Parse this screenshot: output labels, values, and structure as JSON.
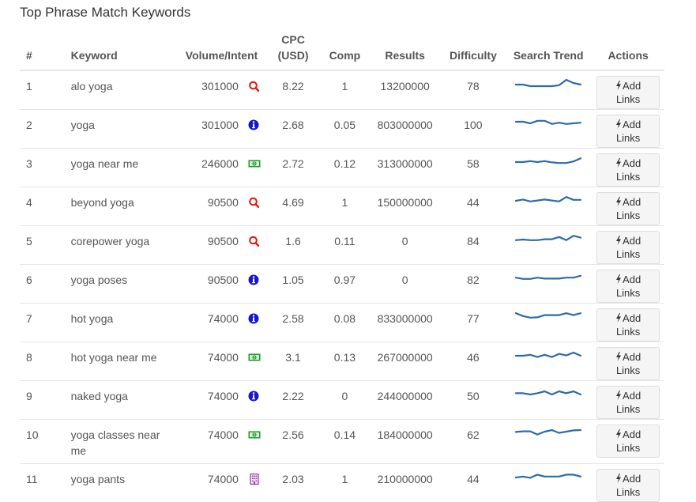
{
  "title": "Top Phrase Match Keywords",
  "colors": {
    "search_intent": "#e8120c",
    "info_intent": "#1515d6",
    "transactional_intent": "#1c9a2b",
    "navigational_intent": "#9b2fae",
    "trend_line": "#2f6aa8"
  },
  "columns": {
    "num": "#",
    "keyword": "Keyword",
    "volume": "Volume/Intent",
    "cpc_line1": "CPC",
    "cpc_line2": "(USD)",
    "comp": "Comp",
    "results": "Results",
    "difficulty": "Difficulty",
    "trend": "Search Trend",
    "actions": "Actions"
  },
  "action_label": "Add Links",
  "rows": [
    {
      "num": "1",
      "keyword": "alo yoga",
      "volume": "301000",
      "intent": "search-icon",
      "cpc": "8.22",
      "comp": "1",
      "results": "13200000",
      "difficulty": "78",
      "trend": [
        5,
        5,
        4.5,
        4.5,
        4.5,
        4.5,
        4.8,
        6.5,
        5.5,
        5
      ]
    },
    {
      "num": "2",
      "keyword": "yoga",
      "volume": "301000",
      "intent": "info-icon",
      "cpc": "2.68",
      "comp": "0.05",
      "results": "803000000",
      "difficulty": "100",
      "trend": [
        5.5,
        5.5,
        5,
        5.8,
        5.8,
        4.8,
        5.2,
        4.8,
        5,
        5.2
      ]
    },
    {
      "num": "3",
      "keyword": "yoga near me",
      "volume": "246000",
      "intent": "money-icon",
      "cpc": "2.72",
      "comp": "0.12",
      "results": "313000000",
      "difficulty": "58",
      "trend": [
        5,
        5,
        5.3,
        5,
        5.3,
        4.9,
        4.7,
        4.7,
        5.2,
        6.2
      ]
    },
    {
      "num": "4",
      "keyword": "beyond yoga",
      "volume": "90500",
      "intent": "search-icon",
      "cpc": "4.69",
      "comp": "1",
      "results": "150000000",
      "difficulty": "44",
      "trend": [
        5,
        5.4,
        4.8,
        5.1,
        5.4,
        5.1,
        4.8,
        6.2,
        5.3,
        5.3
      ]
    },
    {
      "num": "5",
      "keyword": "corepower yoga",
      "volume": "90500",
      "intent": "search-icon",
      "cpc": "1.6",
      "comp": "0.11",
      "results": "0",
      "difficulty": "84",
      "trend": [
        4.8,
        5,
        4.8,
        4.8,
        5.1,
        5.1,
        5.8,
        4.8,
        6.2,
        5.6
      ]
    },
    {
      "num": "6",
      "keyword": "yoga poses",
      "volume": "90500",
      "intent": "info-icon",
      "cpc": "1.05",
      "comp": "0.97",
      "results": "0",
      "difficulty": "82",
      "trend": [
        5.2,
        4.8,
        4.8,
        5.2,
        4.9,
        4.9,
        4.9,
        5.2,
        5.2,
        5.8
      ]
    },
    {
      "num": "7",
      "keyword": "hot yoga",
      "volume": "74000",
      "intent": "info-icon",
      "cpc": "2.58",
      "comp": "0.08",
      "results": "833000000",
      "difficulty": "77",
      "trend": [
        6.2,
        5.3,
        4.8,
        4.9,
        5.6,
        5.6,
        5.6,
        6.2,
        5.6,
        6.2
      ]
    },
    {
      "num": "8",
      "keyword": "hot yoga near me",
      "volume": "74000",
      "intent": "money-icon",
      "cpc": "3.1",
      "comp": "0.13",
      "results": "267000000",
      "difficulty": "46",
      "trend": [
        5,
        5,
        5.3,
        4.6,
        5.3,
        4.6,
        5.6,
        5.1,
        6,
        5
      ]
    },
    {
      "num": "9",
      "keyword": "naked yoga",
      "volume": "74000",
      "intent": "info-icon",
      "cpc": "2.22",
      "comp": "0",
      "results": "244000000",
      "difficulty": "50",
      "trend": [
        5.4,
        5.4,
        5,
        5.4,
        6,
        5,
        6,
        5.4,
        6,
        5
      ]
    },
    {
      "num": "10",
      "keyword": "yoga classes near me",
      "volume": "74000",
      "intent": "money-icon",
      "cpc": "2.56",
      "comp": "0.14",
      "results": "184000000",
      "difficulty": "62",
      "trend": [
        5.4,
        5.6,
        5.6,
        4.6,
        5.5,
        6,
        5.1,
        5.5,
        5.9,
        6
      ]
    },
    {
      "num": "11",
      "keyword": "yoga pants",
      "volume": "74000",
      "intent": "building-icon",
      "cpc": "2.03",
      "comp": "1",
      "results": "210000000",
      "difficulty": "44",
      "trend": [
        5,
        5.3,
        4.9,
        5.9,
        5.3,
        5.3,
        5.3,
        5.9,
        5.9,
        5.3
      ]
    }
  ]
}
